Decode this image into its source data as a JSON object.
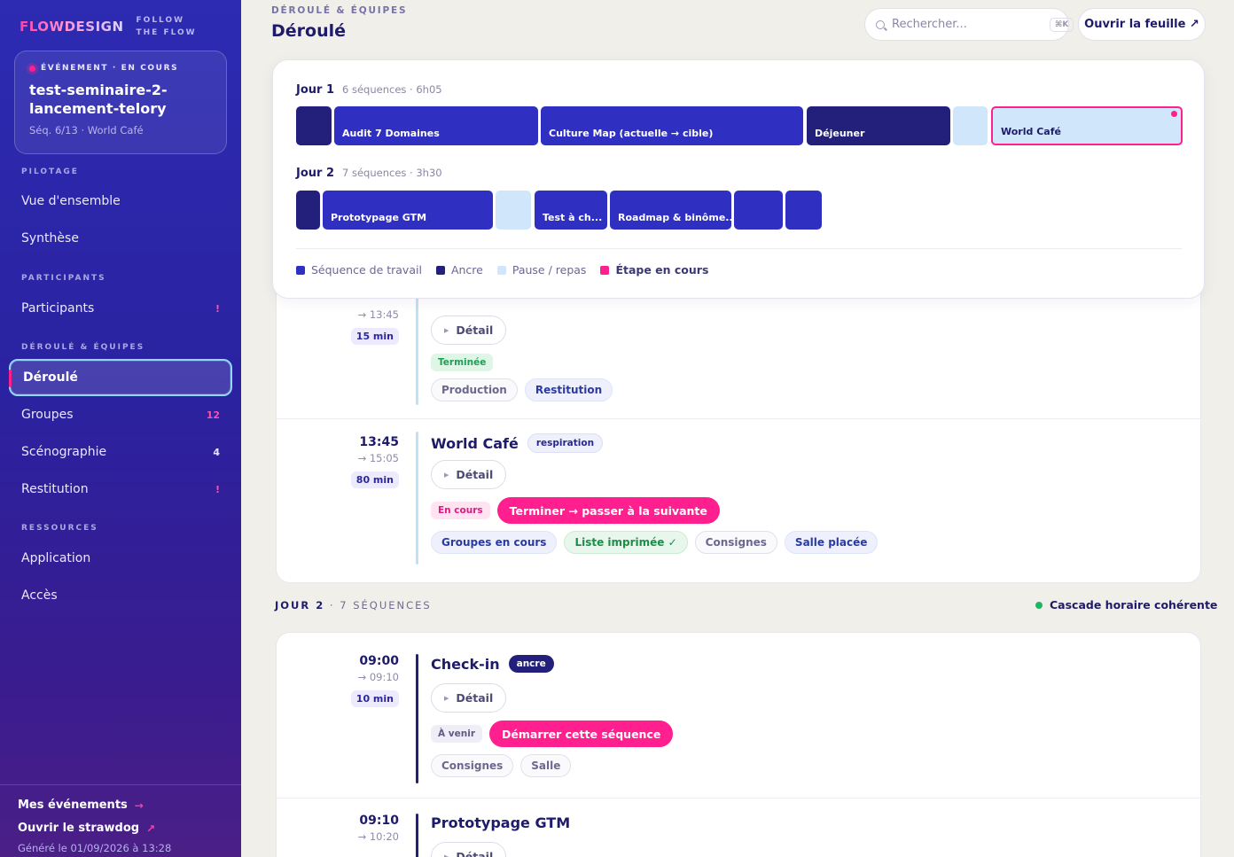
{
  "brand": {
    "logo": "FLOWDESIGN",
    "tagline": "FOLLOW THE FLOW"
  },
  "event": {
    "status": "ÉVÉNEMENT · EN COURS",
    "name": "test-seminaire-2-lancement-telory",
    "sequence": "Séq. 6/13 · World Café"
  },
  "nav": {
    "pilotage": "PILOTAGE",
    "vue": "Vue d'ensemble",
    "synthese": "Synthèse",
    "participants_section": "PARTICIPANTS",
    "participants": "Participants",
    "participants_badge": "!",
    "deroule_section": "DÉROULÉ & ÉQUIPES",
    "deroule": "Déroulé",
    "groupes": "Groupes",
    "groupes_badge": "12",
    "scenographie": "Scénographie",
    "scenographie_badge": "4",
    "restitution": "Restitution",
    "restitution_badge": "!",
    "ressources_section": "RESSOURCES",
    "application": "Application",
    "acces": "Accès"
  },
  "footer": {
    "mes_evenements": "Mes événements",
    "strawdog": "Ouvrir le strawdog",
    "generated": "Généré le 01/09/2026 à 13:28"
  },
  "topbar": {
    "crumb": "DÉROULÉ & ÉQUIPES",
    "title": "Déroulé",
    "search_placeholder": "Rechercher...",
    "search_kbd": "⌘K",
    "open_sheet": "Ouvrir la feuille ↗"
  },
  "timeline": {
    "day1": {
      "name": "Jour 1",
      "meta": "6 séquences · 6h05"
    },
    "day2": {
      "name": "Jour 2",
      "meta": "7 séquences · 3h30"
    },
    "blocks_day1": [
      "",
      "Audit 7 Domaines",
      "Culture Map (actuelle → cible)",
      "Déjeuner",
      "",
      "World Café"
    ],
    "blocks_day2": [
      "",
      "Prototypage GTM",
      "",
      "Test à ch...",
      "Roadmap & binôme...",
      "",
      ""
    ],
    "legend": {
      "work": "Séquence de travail",
      "anchor": "Ancre",
      "pause": "Pause / repas",
      "current": "Étape en cours"
    },
    "colors": {
      "work": "#2f2fc2",
      "anchor": "#22207a",
      "pause": "#cfe6fb",
      "current": "#ff1f8e"
    }
  },
  "seq_prev": {
    "end": "→ 13:45",
    "duration": "15 min",
    "detail": "Détail",
    "status": "Terminée",
    "chips": [
      "Production",
      "Restitution"
    ]
  },
  "seq_current": {
    "start": "13:45",
    "end": "→ 15:05",
    "duration": "80 min",
    "title": "World Café",
    "tag": "respiration",
    "detail": "Détail",
    "status": "En cours",
    "action": "Terminer → passer à la suivante",
    "chips": [
      "Groupes en cours",
      "Liste imprimée ✓",
      "Consignes",
      "Salle placée"
    ]
  },
  "day2": {
    "label": "JOUR 2",
    "count": "· 7 SÉQUENCES",
    "cascade": "Cascade horaire cohérente"
  },
  "seq_checkin": {
    "start": "09:00",
    "end": "→ 09:10",
    "duration": "10 min",
    "title": "Check-in",
    "tag": "ancre",
    "detail": "Détail",
    "status": "À venir",
    "action": "Démarrer cette séquence",
    "chips": [
      "Consignes",
      "Salle"
    ]
  },
  "seq_proto": {
    "start": "09:10",
    "end": "→ 10:20",
    "title": "Prototypage GTM",
    "detail": "Détail"
  }
}
